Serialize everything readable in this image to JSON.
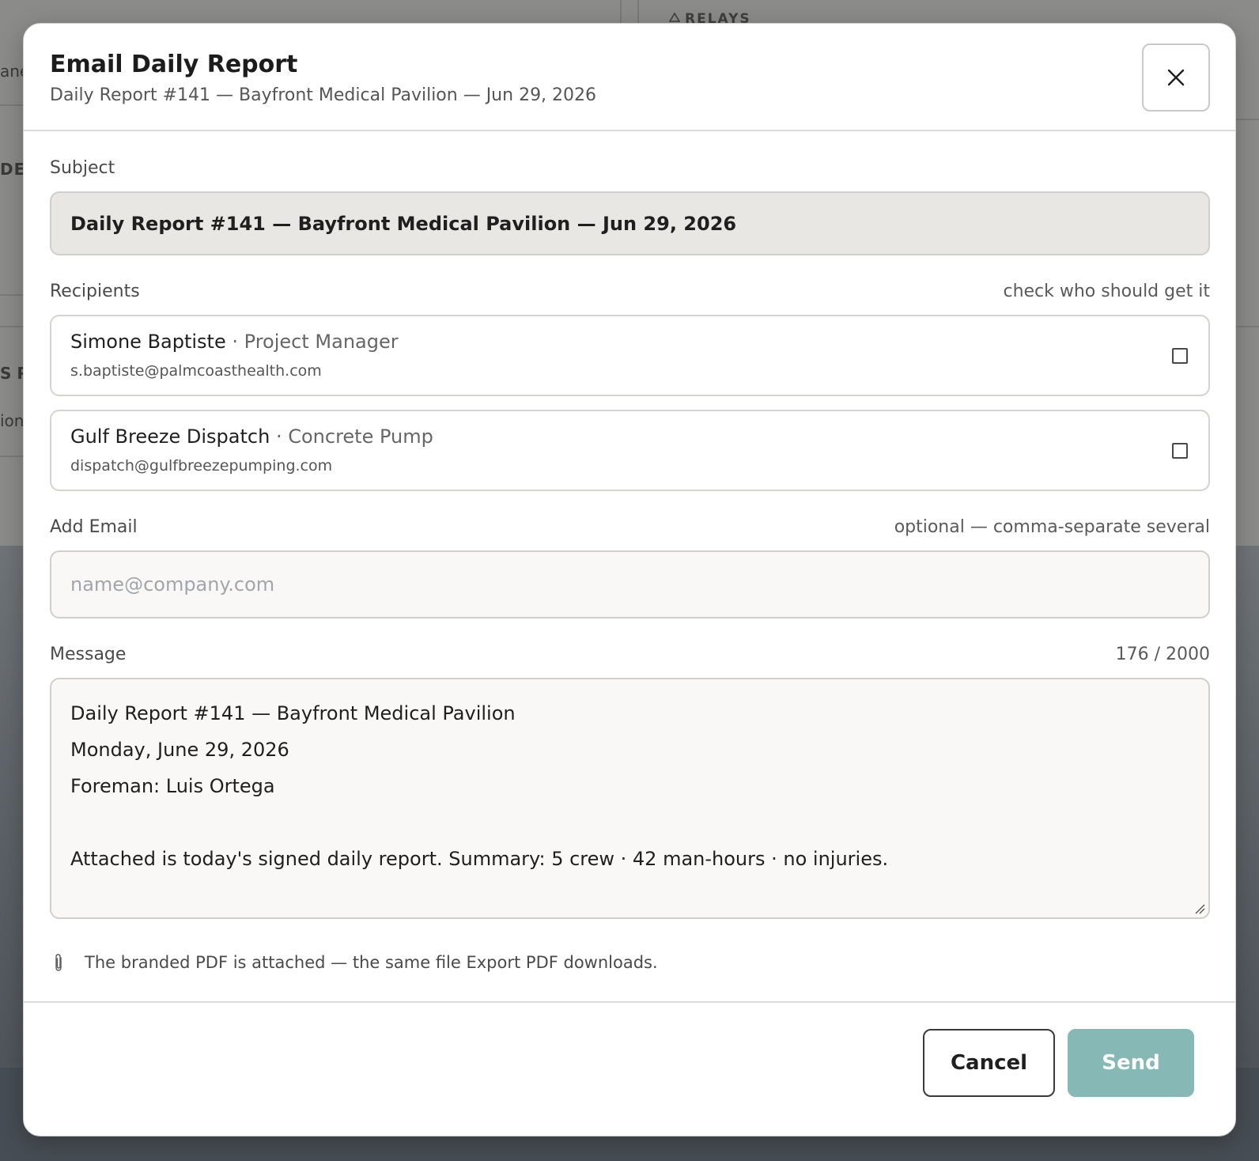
{
  "background": {
    "fragments": [
      "ane",
      "DER",
      "S P",
      "ion"
    ],
    "relays_label": "RELAYS"
  },
  "modal": {
    "title": "Email Daily Report",
    "subtitle": "Daily Report #141 — Bayfront Medical Pavilion — Jun 29, 2026",
    "close_icon": "close-icon"
  },
  "subject": {
    "label": "Subject",
    "value": "Daily Report #141 — Bayfront Medical Pavilion — Jun 29, 2026"
  },
  "recipients": {
    "label": "Recipients",
    "hint": "check who should get it",
    "items": [
      {
        "name": "Simone Baptiste",
        "separator": "·",
        "role": "Project Manager",
        "email": "s.baptiste@palmcoasthealth.com",
        "checked": false
      },
      {
        "name": "Gulf Breeze Dispatch",
        "separator": "·",
        "role": "Concrete Pump",
        "email": "dispatch@gulfbreezepumping.com",
        "checked": false
      }
    ]
  },
  "add_email": {
    "label": "Add Email",
    "hint": "optional — comma-separate several",
    "placeholder": "name@company.com",
    "value": ""
  },
  "message": {
    "label": "Message",
    "counter": "176 / 2000",
    "lines": [
      "Daily Report #141 — Bayfront Medical Pavilion",
      "Monday, June 29, 2026",
      "Foreman: Luis Ortega",
      "",
      "Attached is today's signed daily report. Summary: 5 crew · 42 man-hours · no injuries."
    ]
  },
  "attachment_note": {
    "icon": "paperclip-icon",
    "text": "The branded PDF is attached — the same file Export PDF downloads."
  },
  "footer": {
    "cancel_label": "Cancel",
    "send_label": "Send"
  },
  "colors": {
    "send_button": "#86b8b5",
    "subject_bg": "#e8e7e4",
    "field_bg": "#f9f8f6"
  }
}
